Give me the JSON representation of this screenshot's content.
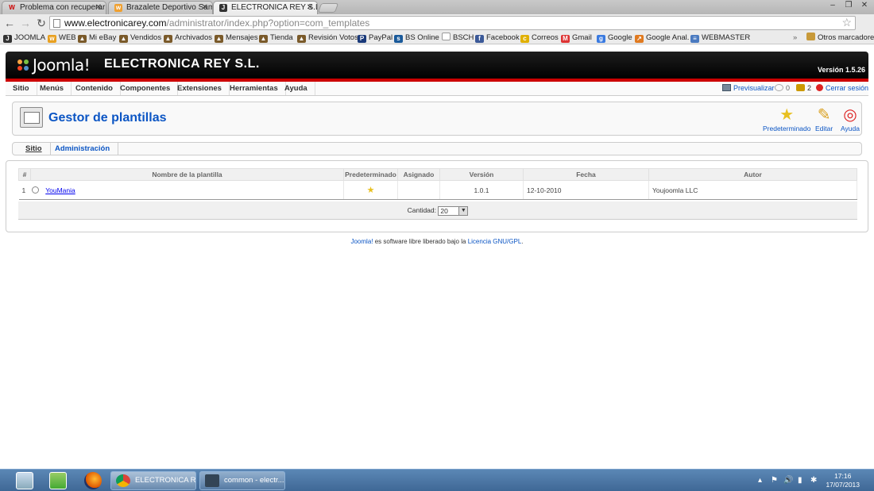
{
  "browser": {
    "tabs": [
      {
        "title": "Problema con recuperar u",
        "favicon": "W",
        "active": false
      },
      {
        "title": "Brazalete Deportivo Sams",
        "favicon": "w",
        "active": false
      },
      {
        "title": "ELECTRONICA REY S.L. - A",
        "favicon": "J",
        "active": true
      }
    ],
    "url_host": "www.electronicarey.com",
    "url_path": "/administrator/index.php?option=com_templates",
    "bookmarks": [
      {
        "label": "JOOMLA",
        "icon": "joomla-icon"
      },
      {
        "label": "WEB",
        "icon": "web-icon"
      },
      {
        "label": "Mi eBay",
        "icon": "ebay-icon"
      },
      {
        "label": "Vendidos",
        "icon": "ebay-icon"
      },
      {
        "label": "Archivados",
        "icon": "ebay-icon"
      },
      {
        "label": "Mensajes",
        "icon": "ebay-icon"
      },
      {
        "label": "Tienda",
        "icon": "ebay-icon"
      },
      {
        "label": "Revisión Votos",
        "icon": "ebay-icon"
      },
      {
        "label": "PayPal",
        "icon": "paypal-icon"
      },
      {
        "label": "BS Online",
        "icon": "bank-icon"
      },
      {
        "label": "BSCH",
        "icon": "page-icon"
      },
      {
        "label": "Facebook",
        "icon": "facebook-icon"
      },
      {
        "label": "Correos",
        "icon": "correos-icon"
      },
      {
        "label": "Gmail",
        "icon": "gmail-icon"
      },
      {
        "label": "Google",
        "icon": "google-icon"
      },
      {
        "label": "Google Anal.",
        "icon": "analytics-icon"
      },
      {
        "label": "WEBMASTER",
        "icon": "webmaster-icon"
      }
    ],
    "other_bookmarks": "Otros marcadores",
    "overflow": "»"
  },
  "joomla": {
    "logo_text": "Joomla!",
    "site_name": "ELECTRONICA REY S.L.",
    "version": "Versión 1.5.26",
    "menu": [
      "Sitio",
      "Menús",
      "Contenido",
      "Componentes",
      "Extensiones",
      "Herramientas",
      "Ayuda"
    ],
    "status": {
      "preview": "Previsualizar",
      "messages": "0",
      "users": "2",
      "logout": "Cerrar sesión"
    },
    "page_title": "Gestor de plantillas",
    "toolbar": {
      "default_label": "Predeterminado",
      "edit_label": "Editar",
      "help_label": "Ayuda"
    },
    "subtabs": [
      {
        "label": "Sitio",
        "active": true
      },
      {
        "label": "Administración",
        "active": false
      }
    ],
    "table": {
      "headers": [
        "#",
        "Nombre de la plantilla",
        "Predeterminado",
        "Asignado",
        "Versión",
        "Fecha",
        "Autor"
      ],
      "rows": [
        {
          "num": "1",
          "name": "YouMania",
          "default": true,
          "assigned": "",
          "version": "1.0.1",
          "date": "12-10-2010",
          "author": "Youjoomla LLC"
        }
      ]
    },
    "pagination": {
      "label": "Cantidad:",
      "value": "20"
    },
    "footer": {
      "brand": "Joomla!",
      "middle": " es software libre liberado bajo la ",
      "license": "Licencia GNU/GPL",
      "end": "."
    }
  },
  "taskbar": {
    "tasks": [
      {
        "label": "ELECTRONICA RE...",
        "active": true
      },
      {
        "label": "common - electr...",
        "active": false
      }
    ],
    "time": "17:16",
    "date": "17/07/2013"
  },
  "colors": {
    "link": "#0b55c4",
    "header_red": "#cc0000",
    "taskbar": "#3f6896"
  }
}
